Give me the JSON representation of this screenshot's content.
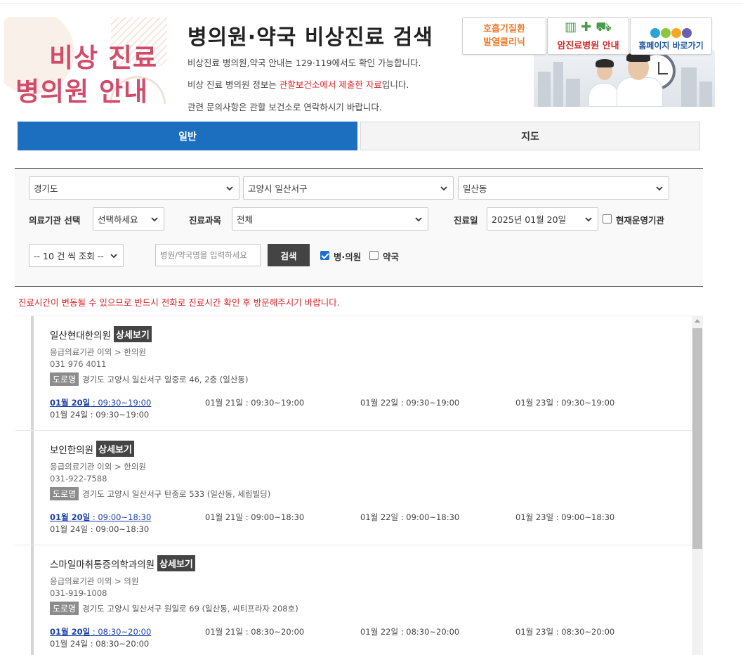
{
  "banner": {
    "left_line1": "비상 진료",
    "left_line2": "병의원 안내",
    "title": "병의원·약국 비상진료 검색",
    "line1": "비상진료 병의원,약국 안내는 129·119에서도 확인 가능합니다.",
    "line2_prefix": "비상 진료 병의원 정보는 ",
    "line2_highlight": "관할보건소에서 제출한 자료",
    "line2_suffix": "입니다.",
    "line3": "관련 문의사항은 관할 보건소로 연락하시기 바랍니다.",
    "highlight_color": "#d9252a"
  },
  "quick_links": {
    "respiratory_line1": "호흡기질환",
    "respiratory_line2": "발열클리닉",
    "cancer": "암진료병원 안내",
    "homepage": "홈페이지 바로가기"
  },
  "tabs": {
    "general": "일반",
    "map": "지도",
    "active_color": "#1b6fbe"
  },
  "filters": {
    "province": "경기도",
    "city": "고양시 일산서구",
    "district": "일산동",
    "institution_label": "의료기관 선택",
    "institution_value": "선택하세요",
    "department_label": "진료과목",
    "department_value": "전체",
    "date_label": "진료일",
    "date_value": "2025년 01월 20일",
    "open_now_label": "현재운영기관",
    "page_size": "-- 10 건 씩 조회 --",
    "search_placeholder": "병원/약국명을 입력하세요",
    "search_button": "검색",
    "hospital_label": "병·의원",
    "pharmacy_label": "약국"
  },
  "notice": "진료시간이 변동될 수 있으므로 반드시 전화로 진료시간 확인 후 방문해주시기 바랍니다.",
  "detail_label": "상세보기",
  "road_label": "도로명",
  "results": [
    {
      "name": "일산현대한의원",
      "category": "응급의료기관 이외 > 한의원",
      "tel": "031 976 4011",
      "address": "경기도 고양시 일산서구 일중로 46, 2층 (일산동)",
      "hours": [
        {
          "date": "01월 20일",
          "time": " : 09:30~19:00"
        },
        {
          "date": "01월 21일",
          "time": " : 09:30~19:00"
        },
        {
          "date": "01월 22일",
          "time": " : 09:30~19:00"
        },
        {
          "date": "01월 23일",
          "time": " : 09:30~19:00"
        },
        {
          "date": "01월 24일",
          "time": " : 09:30~19:00"
        }
      ]
    },
    {
      "name": "보인한의원",
      "category": "응급의료기관 이외 > 한의원",
      "tel": "031-922-7588",
      "address": "경기도 고양시 일산서구 탄중로 533 (일산동, 세림빌딩)",
      "hours": [
        {
          "date": "01월 20일",
          "time": " : 09:00~18:30"
        },
        {
          "date": "01월 21일",
          "time": " : 09:00~18:30"
        },
        {
          "date": "01월 22일",
          "time": " : 09:00~18:30"
        },
        {
          "date": "01월 23일",
          "time": " : 09:00~18:30"
        },
        {
          "date": "01월 24일",
          "time": " : 09:00~18:30"
        }
      ]
    },
    {
      "name": "스마일마취통증의학과의원",
      "category": "응급의료기관 이외 > 의원",
      "tel": "031-919-1008",
      "address": "경기도 고양시 일산서구 원일로 69 (일산동, 씨티프라자 208호)",
      "hours": [
        {
          "date": "01월 20일",
          "time": " : 08:30~20:00"
        },
        {
          "date": "01월 21일",
          "time": " : 08:30~20:00"
        },
        {
          "date": "01월 22일",
          "time": " : 08:30~20:00"
        },
        {
          "date": "01월 23일",
          "time": " : 08:30~20:00"
        },
        {
          "date": "01월 24일",
          "time": " : 08:30~20:00"
        }
      ]
    }
  ]
}
